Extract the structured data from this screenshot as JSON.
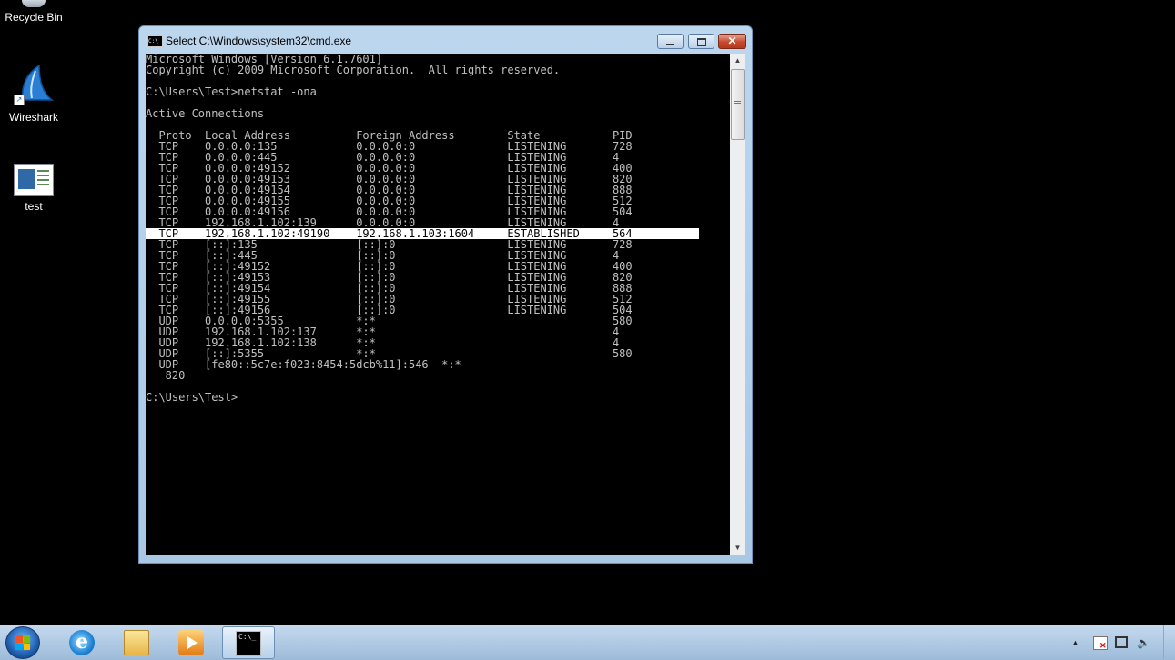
{
  "desktop": {
    "icons": [
      {
        "label": "Recycle Bin"
      },
      {
        "label": "Wireshark"
      },
      {
        "label": "test"
      }
    ]
  },
  "window": {
    "title": "Select C:\\Windows\\system32\\cmd.exe",
    "buttons": {
      "minimize": "minimize",
      "maximize": "maximize",
      "close": "close"
    }
  },
  "console": {
    "header_lines": [
      "Microsoft Windows [Version 6.1.7601]",
      "Copyright (c) 2009 Microsoft Corporation.  All rights reserved.",
      "",
      "C:\\Users\\Test>netstat -ona",
      "",
      "Active Connections",
      "",
      "  Proto  Local Address          Foreign Address        State           PID"
    ],
    "rows": [
      "  TCP    0.0.0.0:135            0.0.0.0:0              LISTENING       728",
      "  TCP    0.0.0.0:445            0.0.0.0:0              LISTENING       4",
      "  TCP    0.0.0.0:49152          0.0.0.0:0              LISTENING       400",
      "  TCP    0.0.0.0:49153          0.0.0.0:0              LISTENING       820",
      "  TCP    0.0.0.0:49154          0.0.0.0:0              LISTENING       888",
      "  TCP    0.0.0.0:49155          0.0.0.0:0              LISTENING       512",
      "  TCP    0.0.0.0:49156          0.0.0.0:0              LISTENING       504",
      "  TCP    192.168.1.102:139      0.0.0.0:0              LISTENING       4",
      "  TCP    192.168.1.102:49190    192.168.1.103:1604     ESTABLISHED     564",
      "  TCP    [::]:135               [::]:0                 LISTENING       728",
      "  TCP    [::]:445               [::]:0                 LISTENING       4",
      "  TCP    [::]:49152             [::]:0                 LISTENING       400",
      "  TCP    [::]:49153             [::]:0                 LISTENING       820",
      "  TCP    [::]:49154             [::]:0                 LISTENING       888",
      "  TCP    [::]:49155             [::]:0                 LISTENING       512",
      "  TCP    [::]:49156             [::]:0                 LISTENING       504",
      "  UDP    0.0.0.0:5355           *:*                                    580",
      "  UDP    192.168.1.102:137      *:*                                    4",
      "  UDP    192.168.1.102:138      *:*                                    4",
      "  UDP    [::]:5355              *:*                                    580",
      "  UDP    [fe80::5c7e:f023:8454:5dcb%11]:546  *:*",
      "   820"
    ],
    "selected_row": 8,
    "footer_lines": [
      "",
      "C:\\Users\\Test>"
    ]
  },
  "taskbar": {
    "items": [
      "start",
      "internet-explorer",
      "windows-explorer",
      "windows-media-player",
      "cmd"
    ]
  }
}
